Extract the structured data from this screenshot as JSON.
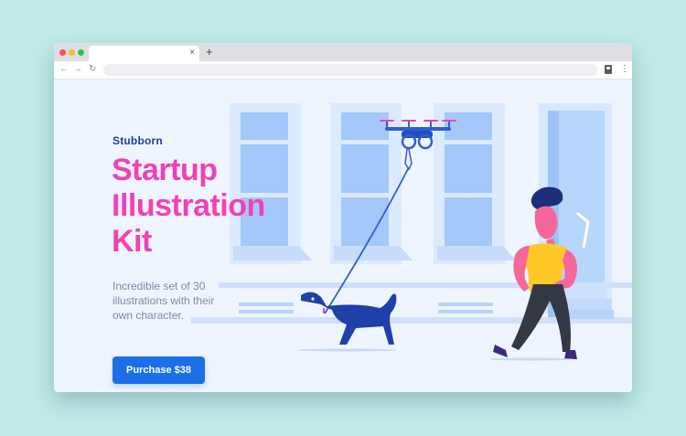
{
  "browser": {
    "tab_close": "×",
    "new_tab": "+",
    "back": "←",
    "forward": "→",
    "reload": "↻",
    "menu": "⋮",
    "address": ""
  },
  "hero": {
    "brand": "Stubborn",
    "title": [
      "Startup",
      "Illustration",
      "Kit"
    ],
    "description": "Incredible set of 30 illustrations with their own character.",
    "cta": "Purchase $38"
  },
  "colors": {
    "background": "#bfeae6",
    "page": "#eef5ff",
    "accent_pink": "#f241b6",
    "brand_blue": "#1f3d8f",
    "button_blue": "#1c6fe6"
  },
  "icons": [
    "close-icon",
    "plus-icon",
    "back-arrow-icon",
    "forward-arrow-icon",
    "reload-icon",
    "profile-icon",
    "menu-icon"
  ]
}
